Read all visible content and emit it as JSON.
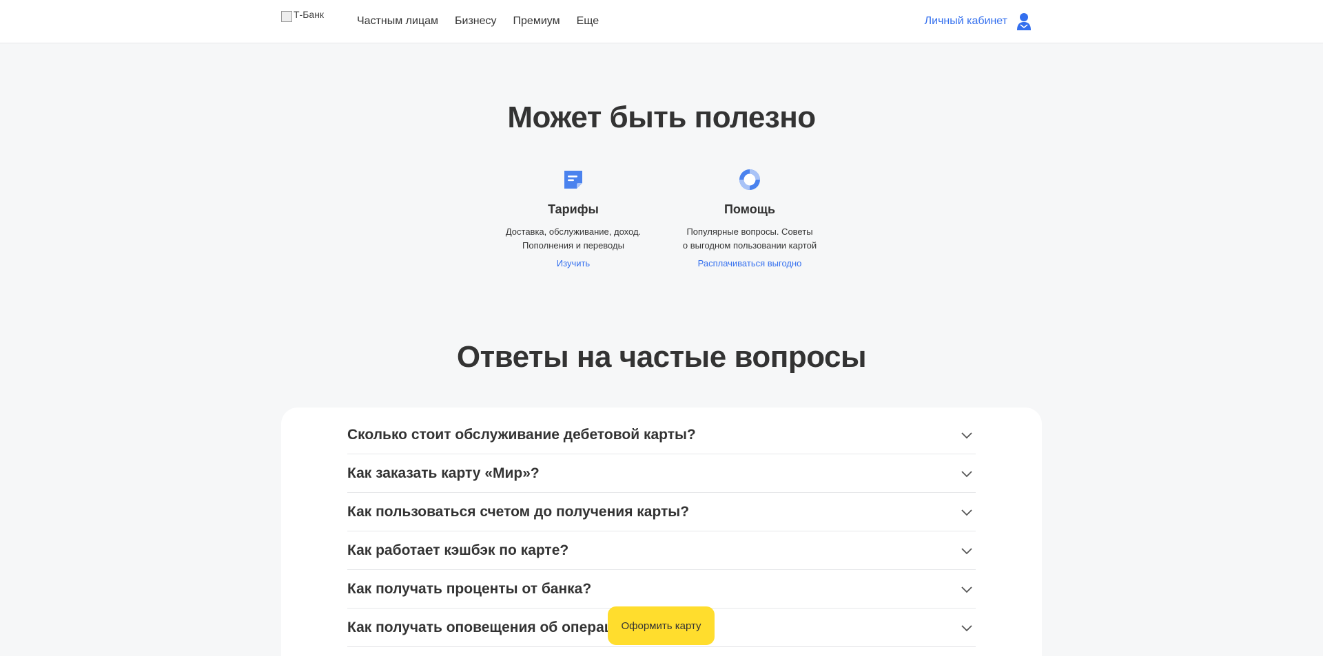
{
  "header": {
    "logo_alt": "Т-Банк",
    "nav": [
      "Частным лицам",
      "Бизнесу",
      "Премиум",
      "Еще"
    ],
    "cabinet_label": "Личный кабинет"
  },
  "useful": {
    "title": "Может быть полезно",
    "cards": [
      {
        "icon": "tariff-document-icon",
        "title": "Тарифы",
        "desc": "Доставка, обслуживание, доход.\nПополнения и переводы",
        "link": "Изучить"
      },
      {
        "icon": "help-lifebuoy-icon",
        "title": "Помощь",
        "desc": "Популярные вопросы. Советы\nо выгодном пользовании картой",
        "link": "Расплачиваться выгодно"
      }
    ]
  },
  "faq": {
    "title": "Ответы на частые вопросы",
    "items": [
      "Сколько стоит обслуживание дебетовой карты?",
      "Как заказать карту «Мир»?",
      "Как пользоваться счетом до получения карты?",
      "Как работает кэшбэк по карте?",
      "Как получать проценты от банка?",
      "Как получать оповещения об операциях?"
    ]
  },
  "cta_label": "Оформить карту",
  "colors": {
    "accent": "#336fee",
    "cta": "#ffdd2d",
    "background": "#f6f7f8"
  }
}
